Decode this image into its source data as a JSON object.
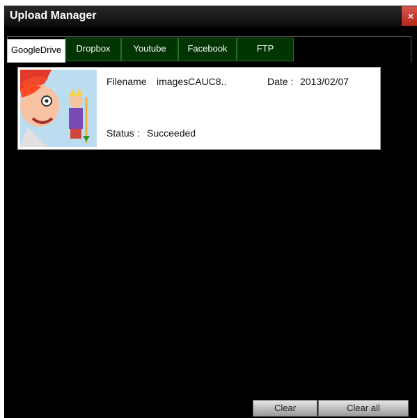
{
  "window": {
    "title": "Upload Manager",
    "close_glyph": "×"
  },
  "tabs": [
    {
      "label": "GoogleDrive",
      "active": true
    },
    {
      "label": "Dropbox",
      "active": false
    },
    {
      "label": "Youtube",
      "active": false
    },
    {
      "label": "Facebook",
      "active": false
    },
    {
      "label": "FTP",
      "active": false
    }
  ],
  "uploads": [
    {
      "filename_label": "Filename",
      "filename": "imagesCAUC8..",
      "date_label": "Date :",
      "date": "2013/02/07",
      "status_label": "Status :",
      "status": "Succeeded",
      "thumbnail_icon": "image-thumbnail"
    }
  ],
  "buttons": {
    "clear": "Clear",
    "clear_all": "Clear all"
  },
  "colors": {
    "window_bg": "#000000",
    "tab_inactive": "#003400",
    "tab_active": "#ffffff",
    "close": "#c8362b"
  }
}
